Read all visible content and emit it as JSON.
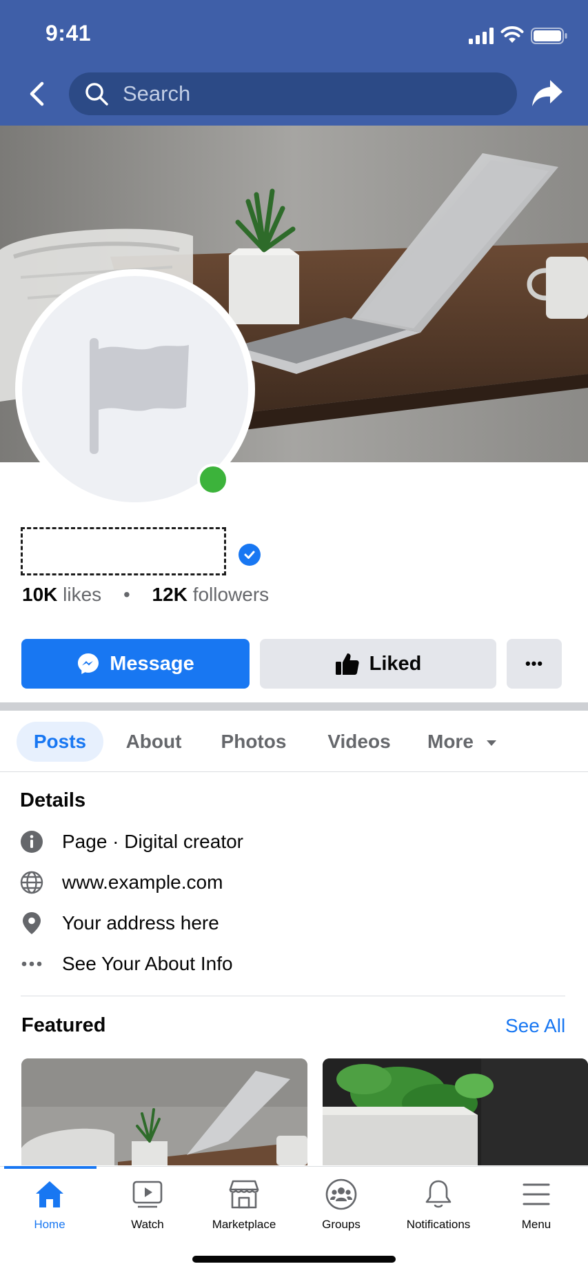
{
  "status_bar": {
    "time": "9:41"
  },
  "header": {
    "search_placeholder": "Search",
    "back_icon": "chevron-left-icon",
    "share_icon": "share-arrow-icon"
  },
  "profile": {
    "likes_count": "10K",
    "likes_label": "likes",
    "separator": "•",
    "followers_count": "12K",
    "followers_label": "followers",
    "online": true,
    "verified": true
  },
  "actions": {
    "message_label": "Message",
    "liked_label": "Liked",
    "more_label": "•••"
  },
  "tabs": [
    {
      "label": "Posts",
      "active": true
    },
    {
      "label": "About",
      "active": false
    },
    {
      "label": "Photos",
      "active": false
    },
    {
      "label": "Videos",
      "active": false
    },
    {
      "label": "More",
      "active": false
    }
  ],
  "details": {
    "title": "Details",
    "items": [
      {
        "icon": "info-icon",
        "text": "Page · Digital creator"
      },
      {
        "icon": "globe-icon",
        "text": "www.example.com"
      },
      {
        "icon": "location-pin-icon",
        "text": "Your address here"
      },
      {
        "icon": "ellipsis-icon",
        "text": "See Your About Info"
      }
    ]
  },
  "featured": {
    "title": "Featured",
    "see_all": "See All"
  },
  "bottom_nav": [
    {
      "label": "Home",
      "icon": "home-icon",
      "active": true
    },
    {
      "label": "Watch",
      "icon": "watch-video-icon",
      "active": false
    },
    {
      "label": "Marketplace",
      "icon": "marketplace-store-icon",
      "active": false
    },
    {
      "label": "Groups",
      "icon": "groups-icon",
      "active": false
    },
    {
      "label": "Notifications",
      "icon": "bell-icon",
      "active": false
    },
    {
      "label": "Menu",
      "icon": "hamburger-menu-icon",
      "active": false
    }
  ],
  "colors": {
    "header_blue": "#3f5fa8",
    "brand_blue": "#1877f2",
    "online_green": "#3cb33b",
    "secondary_text": "#65676b",
    "button_gray": "#e4e6eb"
  }
}
